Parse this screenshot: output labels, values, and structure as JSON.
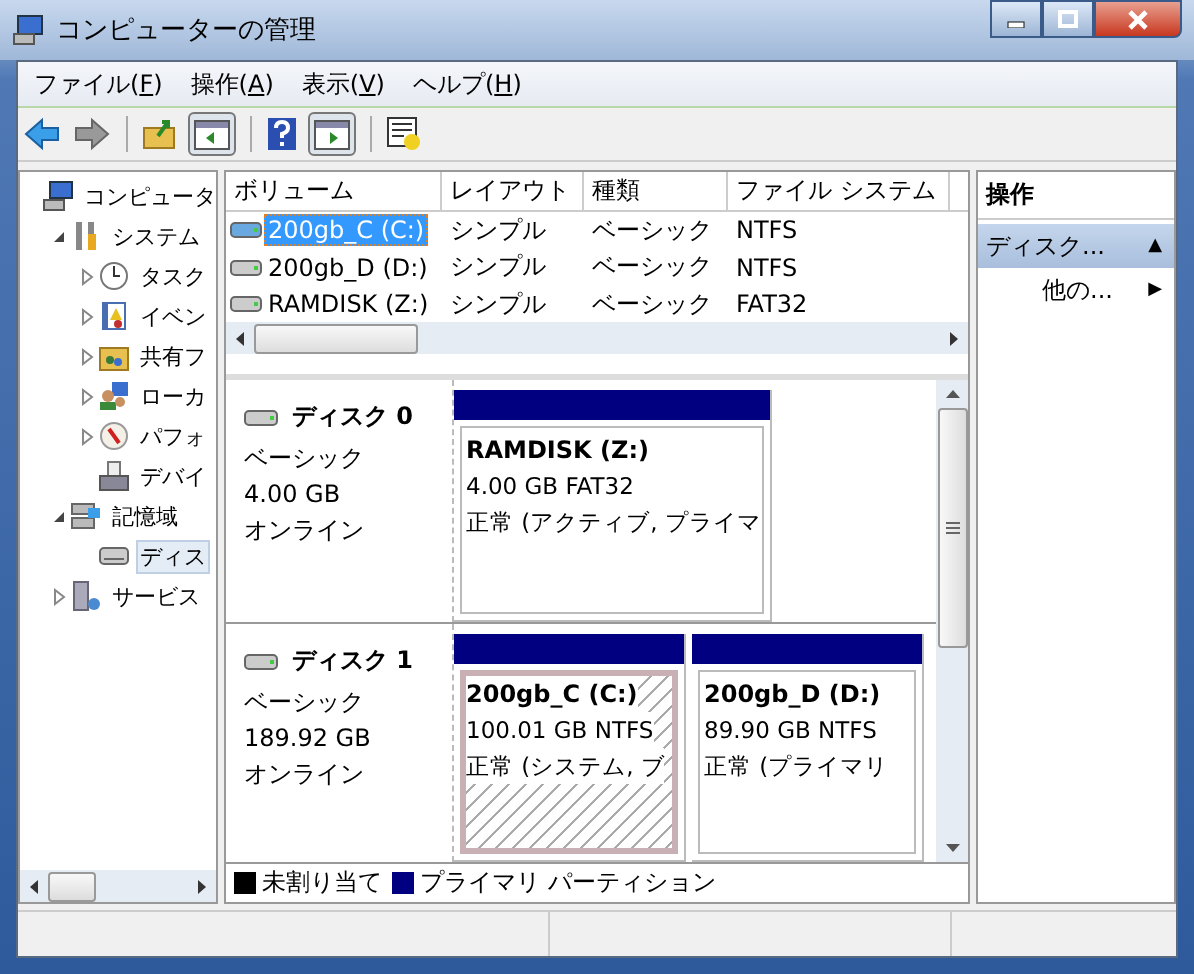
{
  "window": {
    "title": "コンピューターの管理"
  },
  "menu": [
    {
      "before": "ファイル(",
      "key": "F",
      "after": ")"
    },
    {
      "before": "操作(",
      "key": "A",
      "after": ")"
    },
    {
      "before": "表示(",
      "key": "V",
      "after": ")"
    },
    {
      "before": "ヘルプ(",
      "key": "H",
      "after": ")"
    }
  ],
  "tree": [
    {
      "label": "コンピュータ",
      "kind": "computer",
      "selected": false,
      "children": [
        {
          "label": "システム",
          "kind": "tools",
          "expanded": true,
          "selected": false,
          "children": [
            {
              "label": "タスク",
              "kind": "clock",
              "expanded": false,
              "selected": false
            },
            {
              "label": "イベン",
              "kind": "log",
              "expanded": false,
              "selected": false
            },
            {
              "label": "共有フ",
              "kind": "folder",
              "expanded": false,
              "selected": false
            },
            {
              "label": "ローカ",
              "kind": "users",
              "expanded": false,
              "selected": false
            },
            {
              "label": "パフォ",
              "kind": "gauge",
              "expanded": false,
              "selected": false
            },
            {
              "label": "デバイ",
              "kind": "device",
              "selected": false
            }
          ]
        },
        {
          "label": "記憶域",
          "kind": "storage",
          "expanded": true,
          "selected": false,
          "children": [
            {
              "label": "ディス",
              "kind": "disk",
              "selected": true
            }
          ]
        },
        {
          "label": "サービス",
          "kind": "services",
          "expanded": false,
          "selected": false
        }
      ]
    }
  ],
  "volumes": {
    "columns": [
      "ボリューム",
      "レイアウト",
      "種類",
      "ファイル システム"
    ],
    "rows": [
      {
        "cells": [
          "200gb_C (C:)",
          "シンプル",
          "ベーシック",
          "NTFS"
        ],
        "selected": true
      },
      {
        "cells": [
          "200gb_D (D:)",
          "シンプル",
          "ベーシック",
          "NTFS"
        ],
        "selected": false
      },
      {
        "cells": [
          "RAMDISK (Z:)",
          "シンプル",
          "ベーシック",
          "FAT32"
        ],
        "selected": false
      }
    ]
  },
  "disks": [
    {
      "name": "ディスク 0",
      "type": "ベーシック",
      "size": "4.00 GB",
      "status": "オンライン",
      "partitions": [
        {
          "name": "RAMDISK  (Z:)",
          "detail": "4.00 GB FAT32",
          "status": "正常 (アクティブ, プライマ",
          "color": "#000080",
          "selected": false
        }
      ]
    },
    {
      "name": "ディスク 1",
      "type": "ベーシック",
      "size": "189.92 GB",
      "status": "オンライン",
      "partitions": [
        {
          "name": "200gb_C  (C:)",
          "detail": "100.01 GB NTFS",
          "status": "正常 (システム, ブ",
          "color": "#000080",
          "selected": true
        },
        {
          "name": "200gb_D  (D:)",
          "detail": "89.90 GB NTFS",
          "status": "正常 (プライマリ",
          "color": "#000080",
          "selected": false
        }
      ]
    }
  ],
  "legend": [
    {
      "label": "未割り当て",
      "color": "#000000"
    },
    {
      "label": "プライマリ パーティション",
      "color": "#000080"
    }
  ],
  "actions": {
    "title": "操作",
    "items": [
      {
        "label": "ディスク...",
        "arrow": "▲",
        "kind": "section",
        "selected": true
      },
      {
        "label": "他の...",
        "arrow": "▶",
        "kind": "item",
        "selected": false
      }
    ]
  }
}
